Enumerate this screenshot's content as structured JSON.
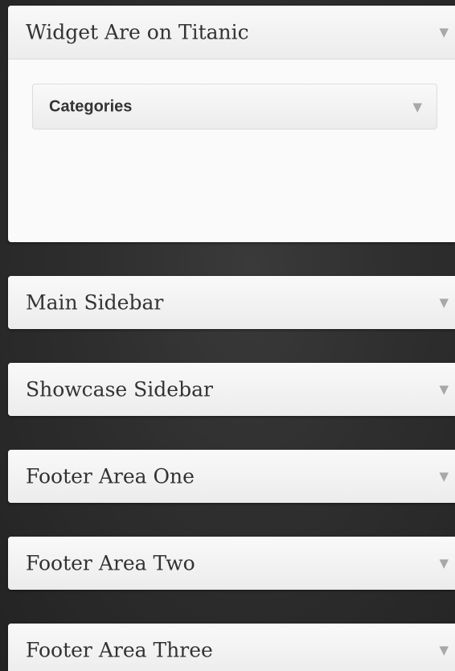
{
  "sidebars": [
    {
      "title": "Widget Are on Titanic",
      "expanded": true,
      "widgets": [
        {
          "title": "Categories"
        }
      ]
    },
    {
      "title": "Main Sidebar",
      "expanded": false
    },
    {
      "title": "Showcase Sidebar",
      "expanded": false
    },
    {
      "title": "Footer Area One",
      "expanded": false
    },
    {
      "title": "Footer Area Two",
      "expanded": false
    },
    {
      "title": "Footer Area Three",
      "expanded": false
    }
  ],
  "toggle_icon": "▼"
}
